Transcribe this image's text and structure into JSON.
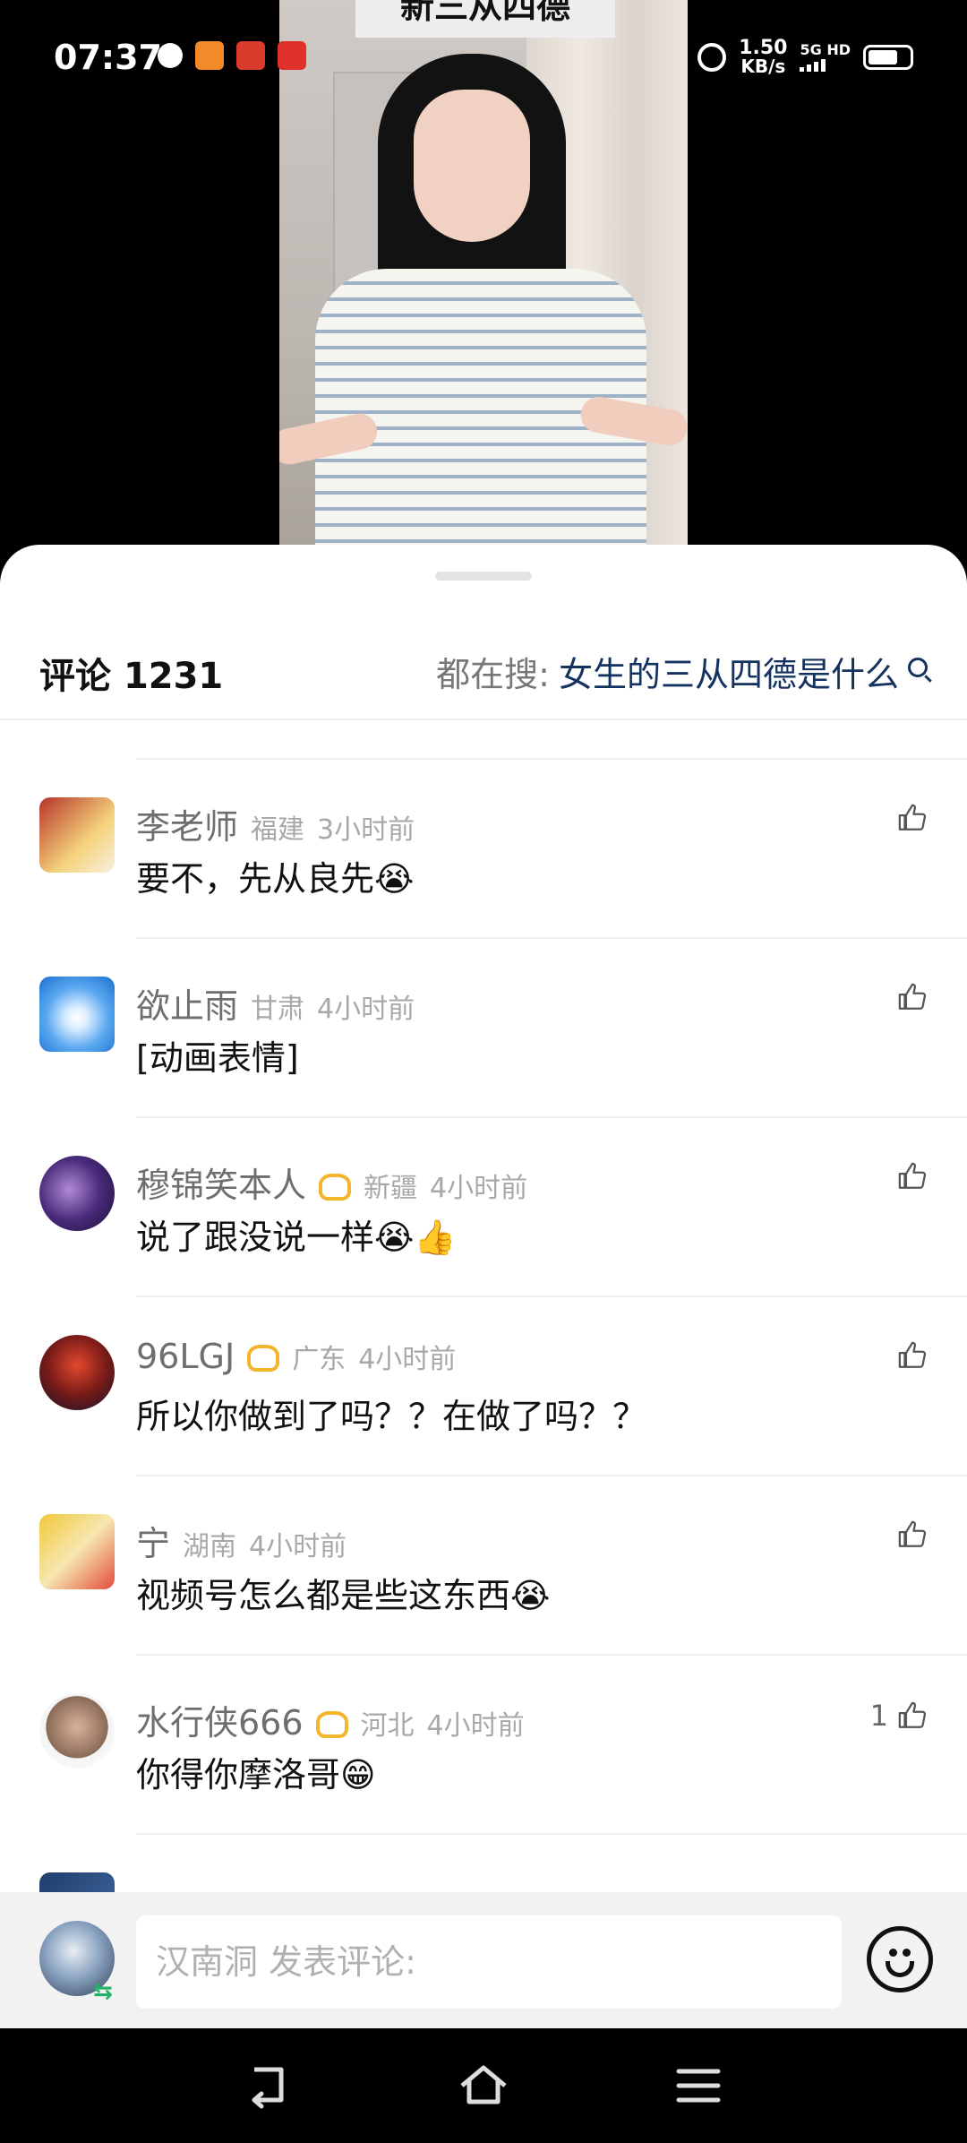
{
  "status_bar": {
    "time": "07:37",
    "net_speed_value": "1.50",
    "net_speed_unit": "KB/s",
    "signal_label": "5G HD",
    "notification_icons": [
      "globe-icon",
      "video-app-icon",
      "app-icon",
      "app-icon"
    ]
  },
  "video": {
    "overlay_title": "新三从四德"
  },
  "comments_header": {
    "label": "评论",
    "count": "1231",
    "trending_prefix": "都在搜:",
    "trending_term": "女生的三从四德是什么"
  },
  "comments": [
    {
      "name": "李老师",
      "badge": false,
      "location": "福建",
      "time": "3小时前",
      "text": "要不，先从良先😭",
      "likes": ""
    },
    {
      "name": "欲止雨",
      "badge": false,
      "location": "甘肃",
      "time": "4小时前",
      "text": "[动画表情]",
      "likes": ""
    },
    {
      "name": "穆锦笑本人",
      "badge": true,
      "location": "新疆",
      "time": "4小时前",
      "text": "说了跟没说一样😭👍",
      "likes": ""
    },
    {
      "name": "96LGJ",
      "badge": true,
      "location": "广东",
      "time": "4小时前",
      "text": "所以你做到了吗？？在做了吗？？",
      "likes": ""
    },
    {
      "name": "宁",
      "badge": false,
      "location": "湖南",
      "time": "4小时前",
      "text": "视频号怎么都是些这东西😭",
      "likes": ""
    },
    {
      "name": "水行侠666",
      "badge": true,
      "location": "河北",
      "time": "4小时前",
      "text": "你得你摩洛哥😁",
      "likes": "1"
    }
  ],
  "input": {
    "placeholder": "汉南洞 发表评论:"
  },
  "colors": {
    "trend_term": "#14325f",
    "badge": "#f2b52b",
    "meta_gray": "#a8a8a8"
  }
}
